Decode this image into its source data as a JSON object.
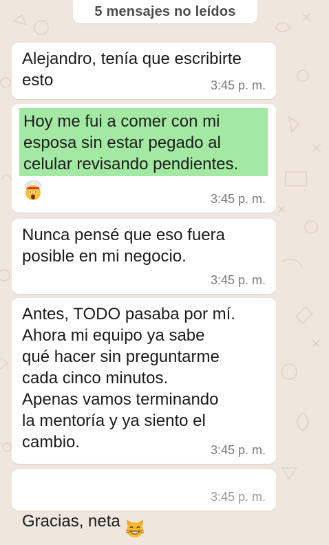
{
  "banner": {
    "unread_label": "5 mensajes no leídos"
  },
  "messages": [
    {
      "text": "Alejandro, tenía que escribirte\nesto",
      "time": "3:45 p. m."
    },
    {
      "text": "Hoy me fui a comer con mi\nesposa sin estar pegado al\ncelular revisando pendientes.",
      "emoji": "exploding-head-emoji",
      "time": "3:45 p. m."
    },
    {
      "text": "Nunca pensé que eso fuera\nposible en mi negocio.",
      "time": "3:45 p. m."
    },
    {
      "text": "Antes, TODO pasaba por mí.\nAhora mi equipo ya sabe\nqué hacer sin preguntarme\ncada cinco minutos.\nApenas vamos terminando\nla mentoría y ya siento el\ncambio.",
      "time": "3:45 p. m."
    },
    {
      "text": "Gracias, neta",
      "emoji": "grinning-cat-emoji",
      "time": "3:45 p. m."
    }
  ],
  "colors": {
    "chat_background": "#efe7de",
    "bubble": "#ffffff",
    "highlight": "#a4e9a3",
    "timestamp": "#7b7b7b"
  }
}
